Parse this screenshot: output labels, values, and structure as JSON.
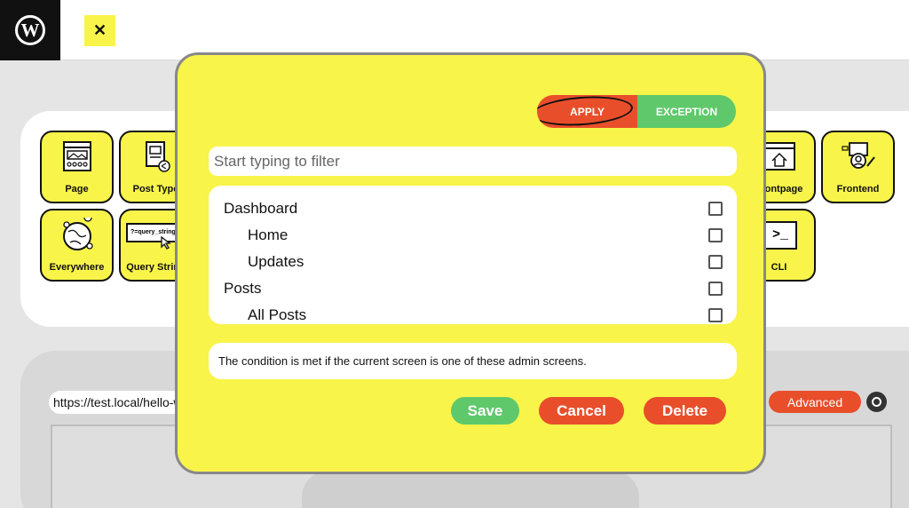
{
  "topbar": {
    "logo_letter": "W",
    "close_symbol": "✕"
  },
  "tiles": [
    {
      "label": "Page",
      "icon": "page-layout-icon"
    },
    {
      "label": "Post Type",
      "icon": "post-type-icon"
    },
    {
      "label": "Frontpage",
      "icon": "frontpage-icon"
    },
    {
      "label": "Frontend",
      "icon": "frontend-icon"
    },
    {
      "label": "Everywhere",
      "icon": "globe-pins-icon"
    },
    {
      "label": "Query String",
      "icon": "query-string-icon"
    },
    {
      "label": "CLI",
      "icon": "terminal-icon"
    }
  ],
  "query_icon_text": "?=query_string",
  "cli_prompt": ">_",
  "url_bar": {
    "value": "https://test.local/hello-world/"
  },
  "advanced_label": "Advanced",
  "modal": {
    "toggle": {
      "apply": "APPLY",
      "exception": "EXCEPTION"
    },
    "filter": {
      "placeholder": "Start typing to filter"
    },
    "screens": [
      {
        "label": "Dashboard",
        "checked": false
      },
      {
        "label": "Home",
        "checked": false
      },
      {
        "label": "Updates",
        "checked": false
      },
      {
        "label": "Posts",
        "checked": false
      },
      {
        "label": "All Posts",
        "checked": false
      }
    ],
    "description": "The condition is met if the current screen is one of these admin screens.",
    "buttons": {
      "save": "Save",
      "cancel": "Cancel",
      "delete": "Delete"
    }
  },
  "colors": {
    "accent_yellow": "#f8f44a",
    "apply_red": "#e94e2b",
    "success_green": "#5fc86b"
  }
}
